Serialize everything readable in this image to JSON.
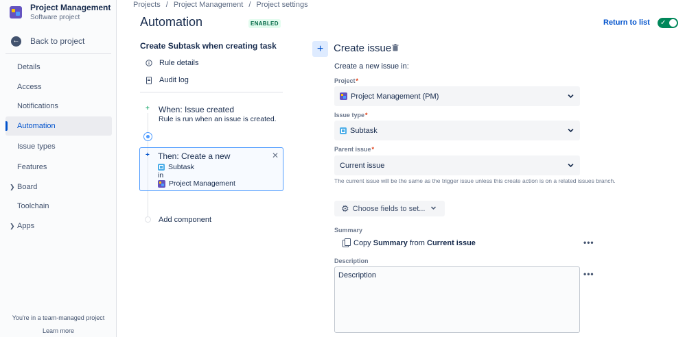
{
  "sidebar": {
    "project_name": "Project Management",
    "project_type": "Software project",
    "back_label": "Back to project",
    "items": [
      {
        "label": "Details"
      },
      {
        "label": "Access"
      },
      {
        "label": "Notifications"
      },
      {
        "label": "Automation",
        "active": true
      },
      {
        "label": "Issue types"
      },
      {
        "label": "Features"
      },
      {
        "label": "Board",
        "expandable": true
      },
      {
        "label": "Toolchain"
      },
      {
        "label": "Apps",
        "expandable": true
      }
    ],
    "footer_text": "You're in a team-managed project",
    "learn_more": "Learn more"
  },
  "breadcrumb": [
    "Projects",
    "Project Management",
    "Project settings"
  ],
  "header": {
    "title": "Automation",
    "badge": "ENABLED",
    "return_link": "Return to list",
    "toggle_on": true
  },
  "rule": {
    "title": "Create Subtask when creating task",
    "links": [
      {
        "label": "Rule details",
        "icon": "info-icon"
      },
      {
        "label": "Audit log",
        "icon": "document-icon"
      }
    ],
    "trigger": {
      "title": "When: Issue created",
      "desc": "Rule is run when an issue is created."
    },
    "action": {
      "title": "Then: Create a new",
      "issue_type": "Subtask",
      "in": "in",
      "project": "Project Management"
    },
    "add_component": "Add component"
  },
  "panel": {
    "title": "Create issue",
    "subtitle": "Create a new issue in:",
    "project_label": "Project",
    "project_value": "Project Management (PM)",
    "issue_type_label": "Issue type",
    "issue_type_value": "Subtask",
    "parent_label": "Parent issue",
    "parent_value": "Current issue",
    "helper": "The current issue will be the same as the trigger issue unless this create action is on a related issues branch.",
    "choose_fields": "Choose fields to set...",
    "summary_label": "Summary",
    "summary_copy": "Copy",
    "summary_field": "Summary",
    "summary_from": "from",
    "summary_source": "Current issue",
    "description_label": "Description",
    "description_value": "Description"
  },
  "colors": {
    "accent": "#0052cc",
    "success": "#00875a",
    "brand_purple": "#6554c0"
  }
}
